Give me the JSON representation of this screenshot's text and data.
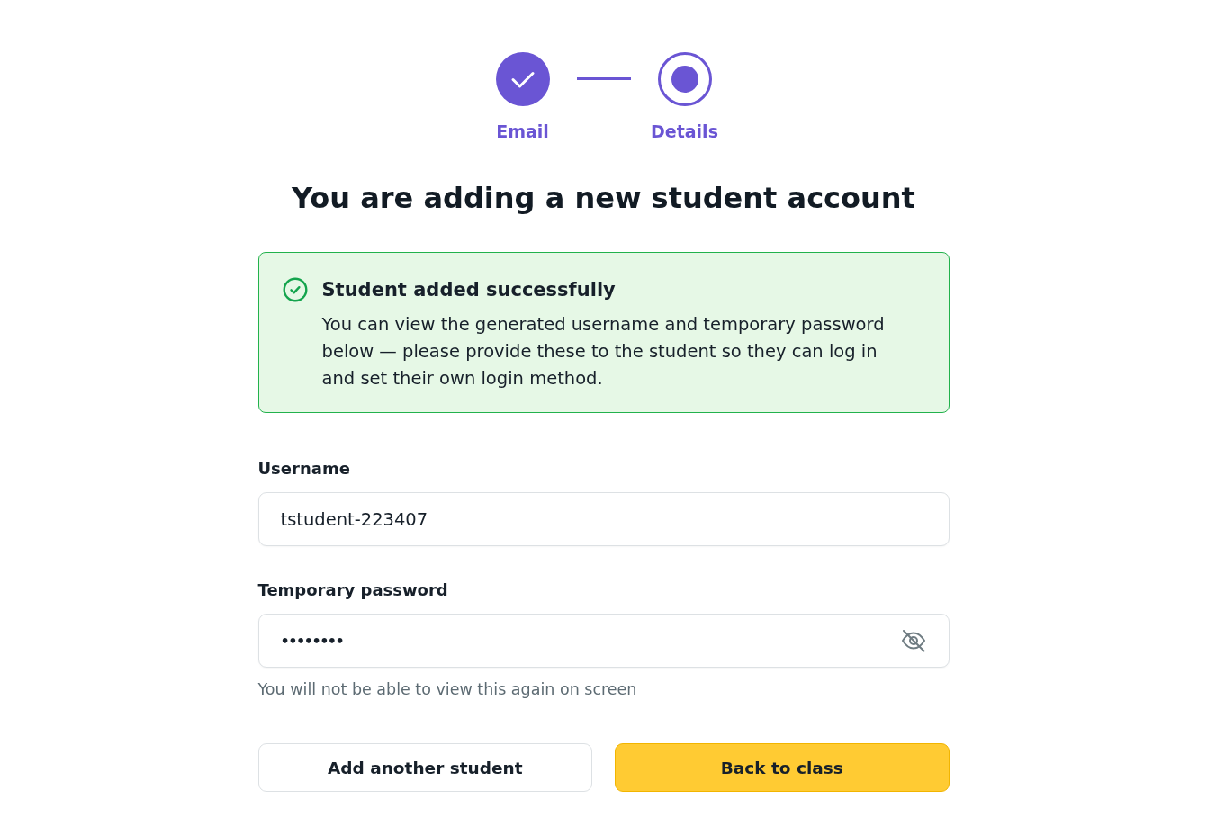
{
  "stepper": {
    "steps": [
      {
        "label": "Email",
        "kind": "done"
      },
      {
        "label": "Details",
        "kind": "current"
      }
    ]
  },
  "title": "You are adding a new student account",
  "alert": {
    "kind": "success",
    "title": "Student added successfully",
    "message": "You can view the generated username and temporary password below — please provide these to the student so they can log in and set their own login method."
  },
  "fields": [
    {
      "kind": "text",
      "label": "Username",
      "value": "tstudent-223407"
    },
    {
      "kind": "password",
      "label": "Temporary password",
      "value": "••••••••",
      "masked": true,
      "hint": "You will not be able to view this again on screen"
    }
  ],
  "buttons": [
    {
      "label": "Add another student",
      "kind": "secondary"
    },
    {
      "label": "Back to class",
      "kind": "primary"
    }
  ]
}
